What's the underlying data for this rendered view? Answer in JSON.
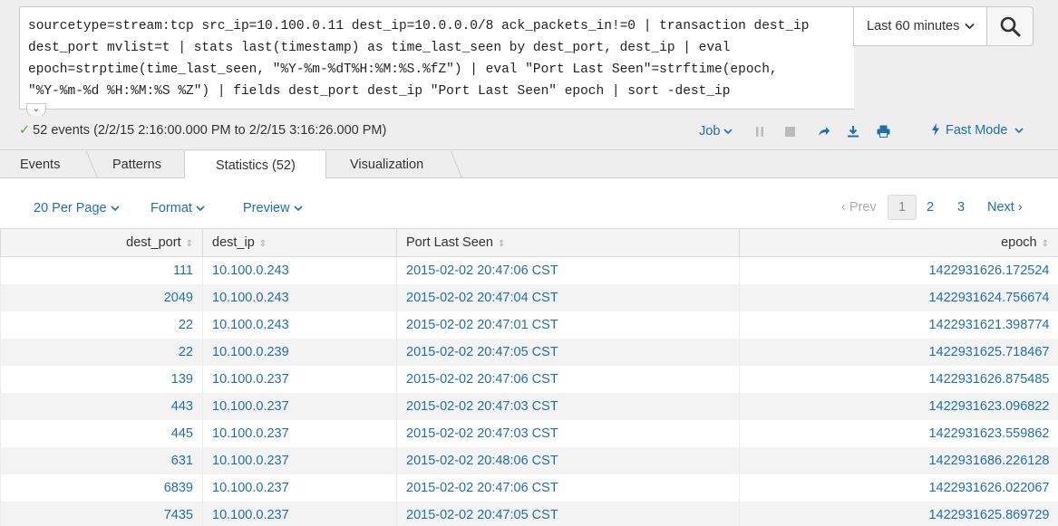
{
  "search": {
    "query_lines": [
      "sourcetype=stream:tcp src_ip=10.100.0.11 dest_ip=10.0.0.0/8 ack_packets_in!=0 | transaction dest_ip",
      "dest_port mvlist=t | stats last(timestamp) as time_last_seen by dest_port, dest_ip | eval",
      "epoch=strptime(time_last_seen, \"%Y-%m-%dT%H:%M:%S.%fZ\") | eval \"Port Last Seen\"=strftime(epoch,",
      "\"%Y-%m-%d %H:%M:%S %Z\") | fields dest_port dest_ip \"Port Last Seen\" epoch | sort -dest_ip"
    ],
    "time_range": "Last 60 minutes"
  },
  "status": {
    "events_summary": "52 events (2/2/15 2:16:00.000 PM to 2/2/15 3:16:26.000 PM)",
    "job_label": "Job",
    "mode_label": "Fast Mode"
  },
  "tabs": [
    {
      "label": "Events"
    },
    {
      "label": "Patterns"
    },
    {
      "label": "Statistics (52)"
    },
    {
      "label": "Visualization"
    }
  ],
  "toolbar": {
    "per_page": "20 Per Page",
    "format": "Format",
    "preview": "Preview"
  },
  "pagination": {
    "prev": "Prev",
    "pages": [
      "1",
      "2",
      "3"
    ],
    "current": "1",
    "next": "Next"
  },
  "table": {
    "columns": [
      "dest_port",
      "dest_ip",
      "Port Last Seen",
      "epoch"
    ],
    "rows": [
      [
        "111",
        "10.100.0.243",
        "2015-02-02 20:47:06 CST",
        "1422931626.172524"
      ],
      [
        "2049",
        "10.100.0.243",
        "2015-02-02 20:47:04 CST",
        "1422931624.756674"
      ],
      [
        "22",
        "10.100.0.243",
        "2015-02-02 20:47:01 CST",
        "1422931621.398774"
      ],
      [
        "22",
        "10.100.0.239",
        "2015-02-02 20:47:05 CST",
        "1422931625.718467"
      ],
      [
        "139",
        "10.100.0.237",
        "2015-02-02 20:47:06 CST",
        "1422931626.875485"
      ],
      [
        "443",
        "10.100.0.237",
        "2015-02-02 20:47:03 CST",
        "1422931623.096822"
      ],
      [
        "445",
        "10.100.0.237",
        "2015-02-02 20:47:03 CST",
        "1422931623.559862"
      ],
      [
        "631",
        "10.100.0.237",
        "2015-02-02 20:48:06 CST",
        "1422931686.226128"
      ],
      [
        "6839",
        "10.100.0.237",
        "2015-02-02 20:47:06 CST",
        "1422931626.022067"
      ],
      [
        "7435",
        "10.100.0.237",
        "2015-02-02 20:47:05 CST",
        "1422931625.869729"
      ]
    ]
  },
  "colors": {
    "link": "#1e6fad",
    "success": "#5a9b3a",
    "background": "#eeeeee"
  }
}
